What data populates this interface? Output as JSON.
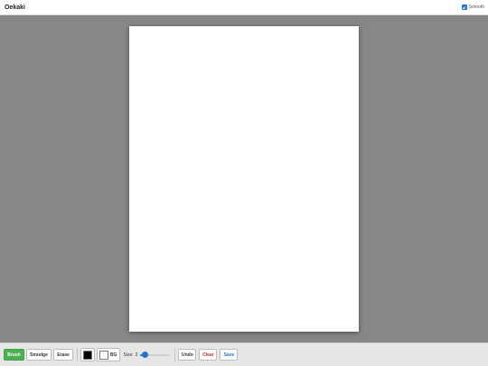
{
  "app": {
    "title": "Oekaki"
  },
  "options": {
    "smooth_label": "Smooth",
    "smooth_checked": true
  },
  "toolbar": {
    "tools": [
      {
        "label": "Brush",
        "active": true
      },
      {
        "label": "Smudge",
        "active": false
      },
      {
        "label": "Erase",
        "active": false
      }
    ],
    "colors": {
      "foreground": "#000000",
      "background": "#ffffff",
      "bg_label": "BG"
    },
    "size": {
      "label": "Size:",
      "value": "3",
      "fraction": 0.05
    },
    "actions": {
      "undo_label": "Undo",
      "clear_label": "Clear",
      "save_label": "Save"
    }
  },
  "theme": {
    "accent": "#4caf50",
    "slider": "#1e74d9",
    "clear_color": "#d32f2f",
    "workspace": "#878787",
    "canvas": "#ffffff"
  }
}
